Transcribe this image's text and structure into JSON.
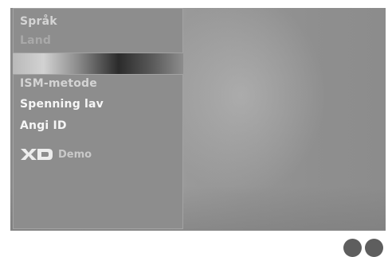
{
  "menu": {
    "top_items": [
      {
        "label": "Språk"
      },
      {
        "label": "Land"
      }
    ],
    "items": [
      {
        "label": "ISM-metode"
      },
      {
        "label": "Spenning lav"
      },
      {
        "label": "Angi ID"
      }
    ],
    "xd_demo": {
      "logo_text": "XD",
      "label": "Demo"
    }
  },
  "remote_buttons": [
    {
      "icon": "round-button"
    },
    {
      "icon": "round-button"
    }
  ]
}
